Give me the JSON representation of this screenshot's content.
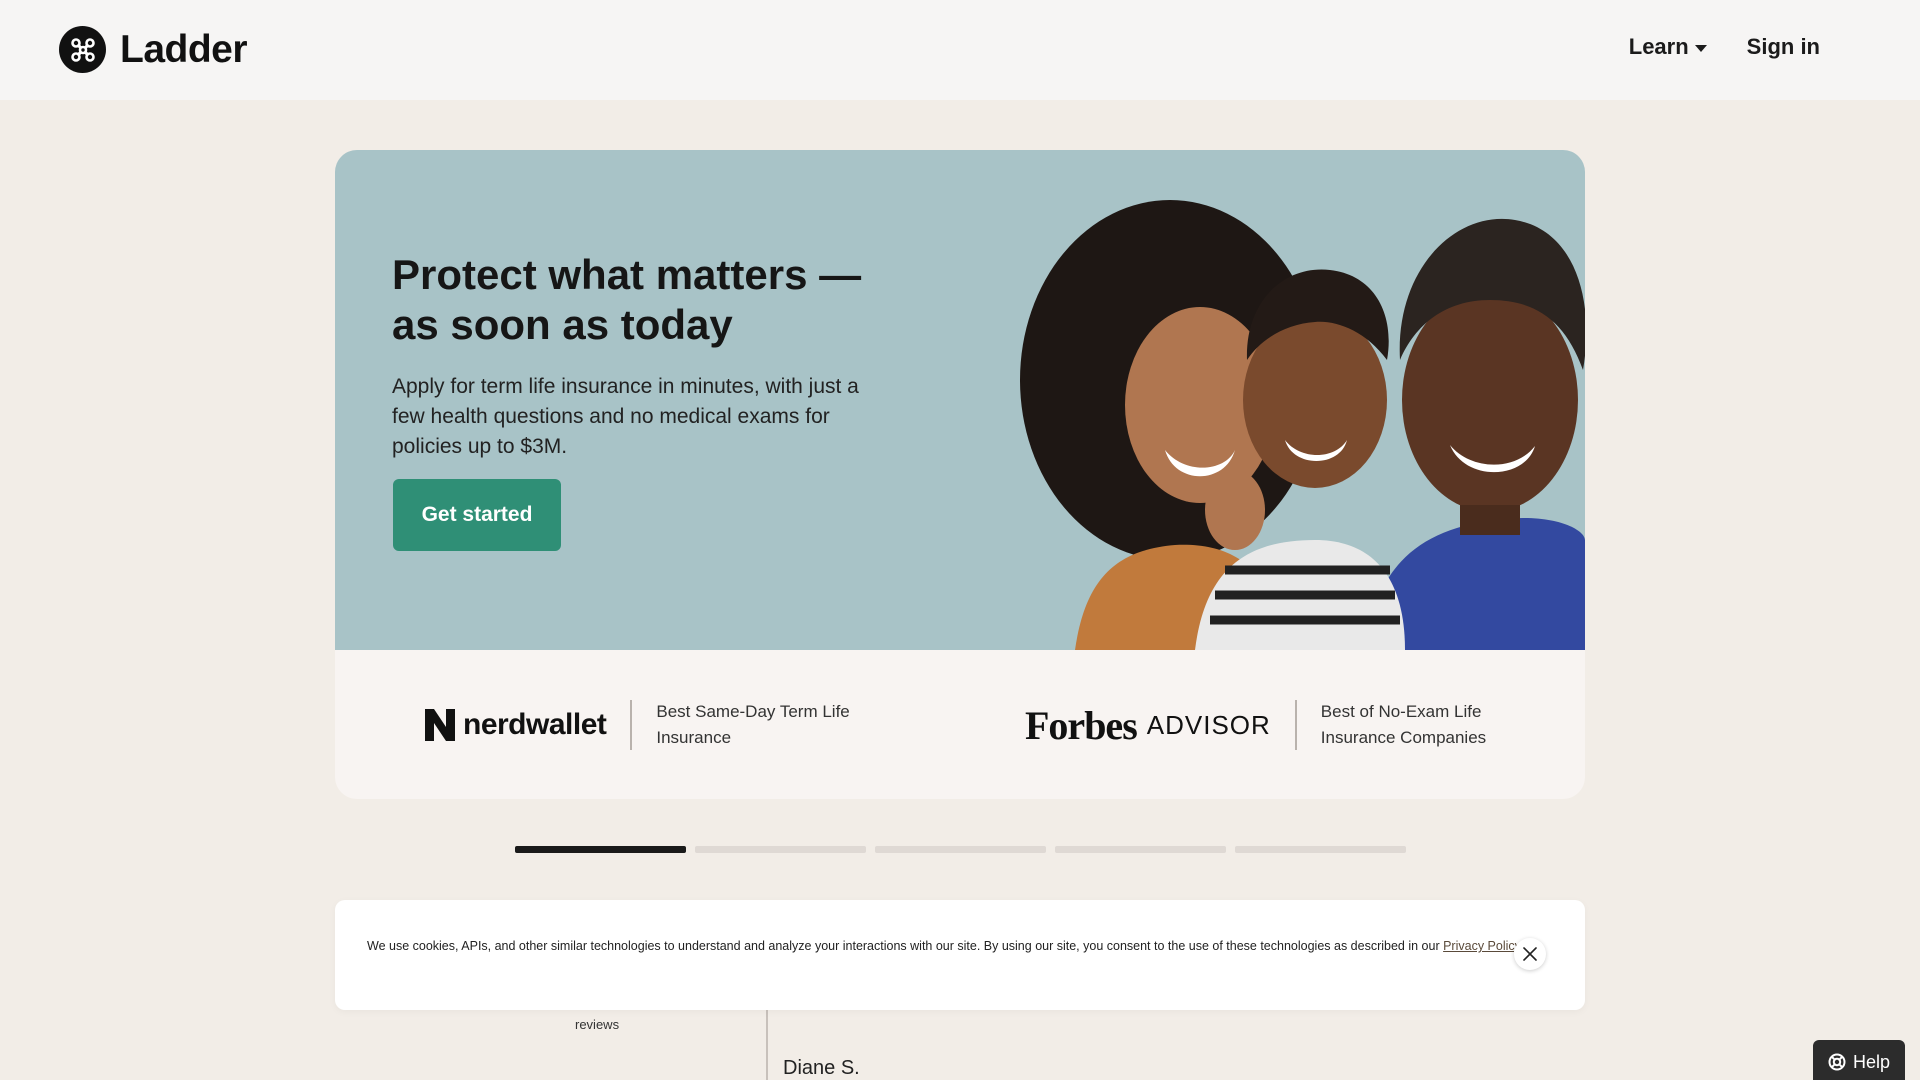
{
  "header": {
    "brand": "Ladder",
    "nav": [
      {
        "label": "Learn",
        "icon": "chevron-down-icon"
      },
      {
        "label": "Sign in"
      }
    ]
  },
  "hero": {
    "title": "Protect what matters — as soon as today",
    "subtitle": "Apply for term life insurance in minutes, with just a few health questions and no medical exams for policies up to $3M.",
    "cta_label": "Get started",
    "background_color": "#a8c3c7",
    "cta_color": "#2f8f76"
  },
  "press": [
    {
      "brand": "nerdwallet",
      "quote": "Best Same-Day Term Life Insurance"
    },
    {
      "brand_primary": "Forbes",
      "brand_secondary": "ADVISOR",
      "quote": "Best of No-Exam Life Insurance Companies"
    }
  ],
  "carousel": {
    "slide_count": 5,
    "active_index": 0
  },
  "below_fold": {
    "reviews_label": "reviews",
    "reviewer_name": "Diane S."
  },
  "cookie_banner": {
    "text": "We use cookies, APIs, and other similar technologies to understand and analyze your interactions with our site. By using our site, you consent to the use of these technologies as described in our",
    "link_label": "Privacy Policy",
    "trailing": "."
  },
  "help": {
    "label": "Help",
    "icon": "lifebuoy-icon"
  }
}
